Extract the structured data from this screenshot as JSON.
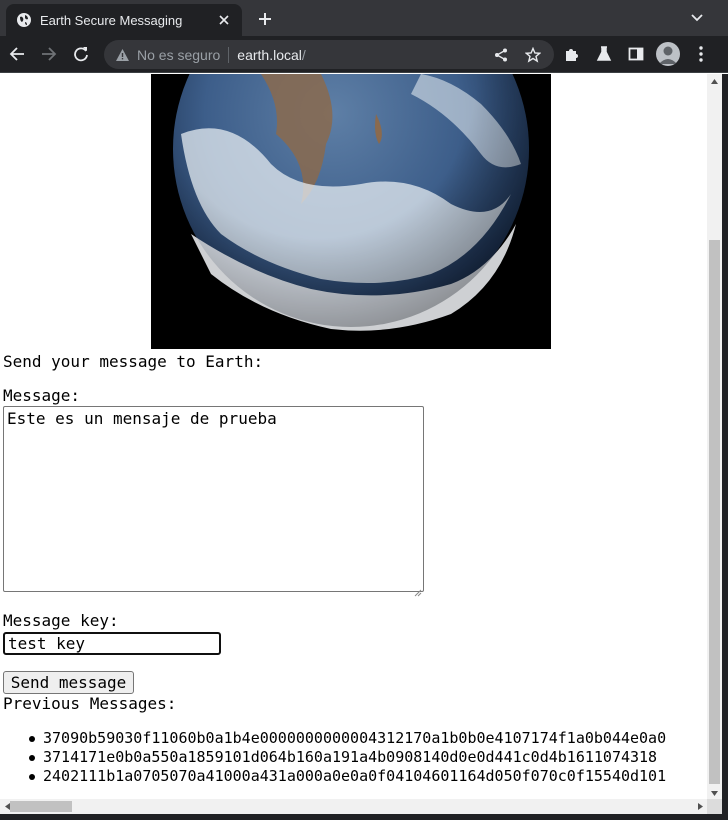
{
  "browser": {
    "tab_title": "Earth Secure Messaging",
    "omnibox": {
      "security_label": "No es seguro",
      "host": "earth.local",
      "path": "/"
    }
  },
  "page": {
    "image_alt": "Earth",
    "send_heading": "Send your message to Earth:",
    "message_label": "Message:",
    "message_value": "Este es un mensaje de prueba",
    "key_label": "Message key:",
    "key_value": "test key",
    "send_button": "Send message",
    "previous_heading": "Previous Messages:",
    "previous_messages": [
      "37090b59030f11060b0a1b4e0000000000004312170a1b0b0e4107174f1a0b044e0a0",
      "3714171e0b0a550a1859101d064b160a191a4b0908140d0e0d441c0d4b1611074318",
      "2402111b1a0705070a41000a431a000a0e0a0f04104601164d050f070c0f15540d101"
    ]
  }
}
